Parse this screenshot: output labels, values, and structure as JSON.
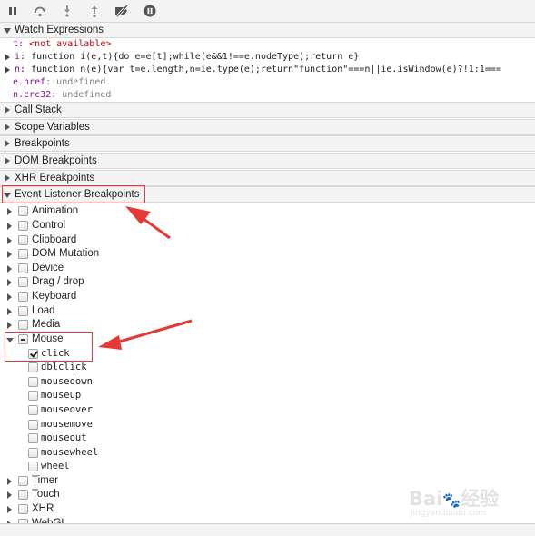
{
  "toolbar": {
    "buttons": [
      "pause-icon",
      "step-over-icon",
      "step-into-icon",
      "step-out-icon",
      "deactivate-breakpoints-icon",
      "pause-on-exceptions-icon"
    ]
  },
  "sections": {
    "watch": "Watch Expressions",
    "call_stack": "Call Stack",
    "scope": "Scope Variables",
    "breakpoints": "Breakpoints",
    "dom_breakpoints": "DOM Breakpoints",
    "xhr_breakpoints": "XHR Breakpoints",
    "event_listener": "Event Listener Breakpoints"
  },
  "watch": [
    {
      "name": "t",
      "sep": ": ",
      "value": "<not available>",
      "kind": "error",
      "expandable": false
    },
    {
      "name": "i",
      "sep": ": ",
      "value": "function i(e,t){do e=e[t];while(e&&1!==e.nodeType);return e}",
      "kind": "fn",
      "expandable": true
    },
    {
      "name": "n",
      "sep": ": ",
      "value": "function n(e){var t=e.length,n=ie.type(e);return\"function\"===n||ie.isWindow(e)?!1:1===",
      "kind": "fn",
      "expandable": true
    },
    {
      "name": "e.href",
      "sep": ": ",
      "value": "undefined",
      "kind": "gray",
      "expandable": false
    },
    {
      "name": "n.crc32",
      "sep": ": ",
      "value": "undefined",
      "kind": "gray",
      "expandable": false
    }
  ],
  "categories_before": [
    "Animation",
    "Control",
    "Clipboard",
    "DOM Mutation",
    "Device",
    "Drag / drop",
    "Keyboard",
    "Load",
    "Media"
  ],
  "mouse": {
    "label": "Mouse",
    "events": [
      {
        "name": "click",
        "checked": true
      },
      {
        "name": "dblclick",
        "checked": false
      },
      {
        "name": "mousedown",
        "checked": false
      },
      {
        "name": "mouseup",
        "checked": false
      },
      {
        "name": "mouseover",
        "checked": false
      },
      {
        "name": "mousemove",
        "checked": false
      },
      {
        "name": "mouseout",
        "checked": false
      },
      {
        "name": "mousewheel",
        "checked": false
      },
      {
        "name": "wheel",
        "checked": false
      }
    ]
  },
  "categories_after": [
    "Timer",
    "Touch",
    "XHR",
    "WebGL"
  ],
  "colors": {
    "highlight": "#e53935",
    "panel_bg": "#f3f3f3",
    "property_name": "#881391",
    "error": "#c80000"
  },
  "watermark": {
    "brand": "Bai",
    "brand_cn": "经验",
    "url": "jingyan.baidu.com"
  }
}
